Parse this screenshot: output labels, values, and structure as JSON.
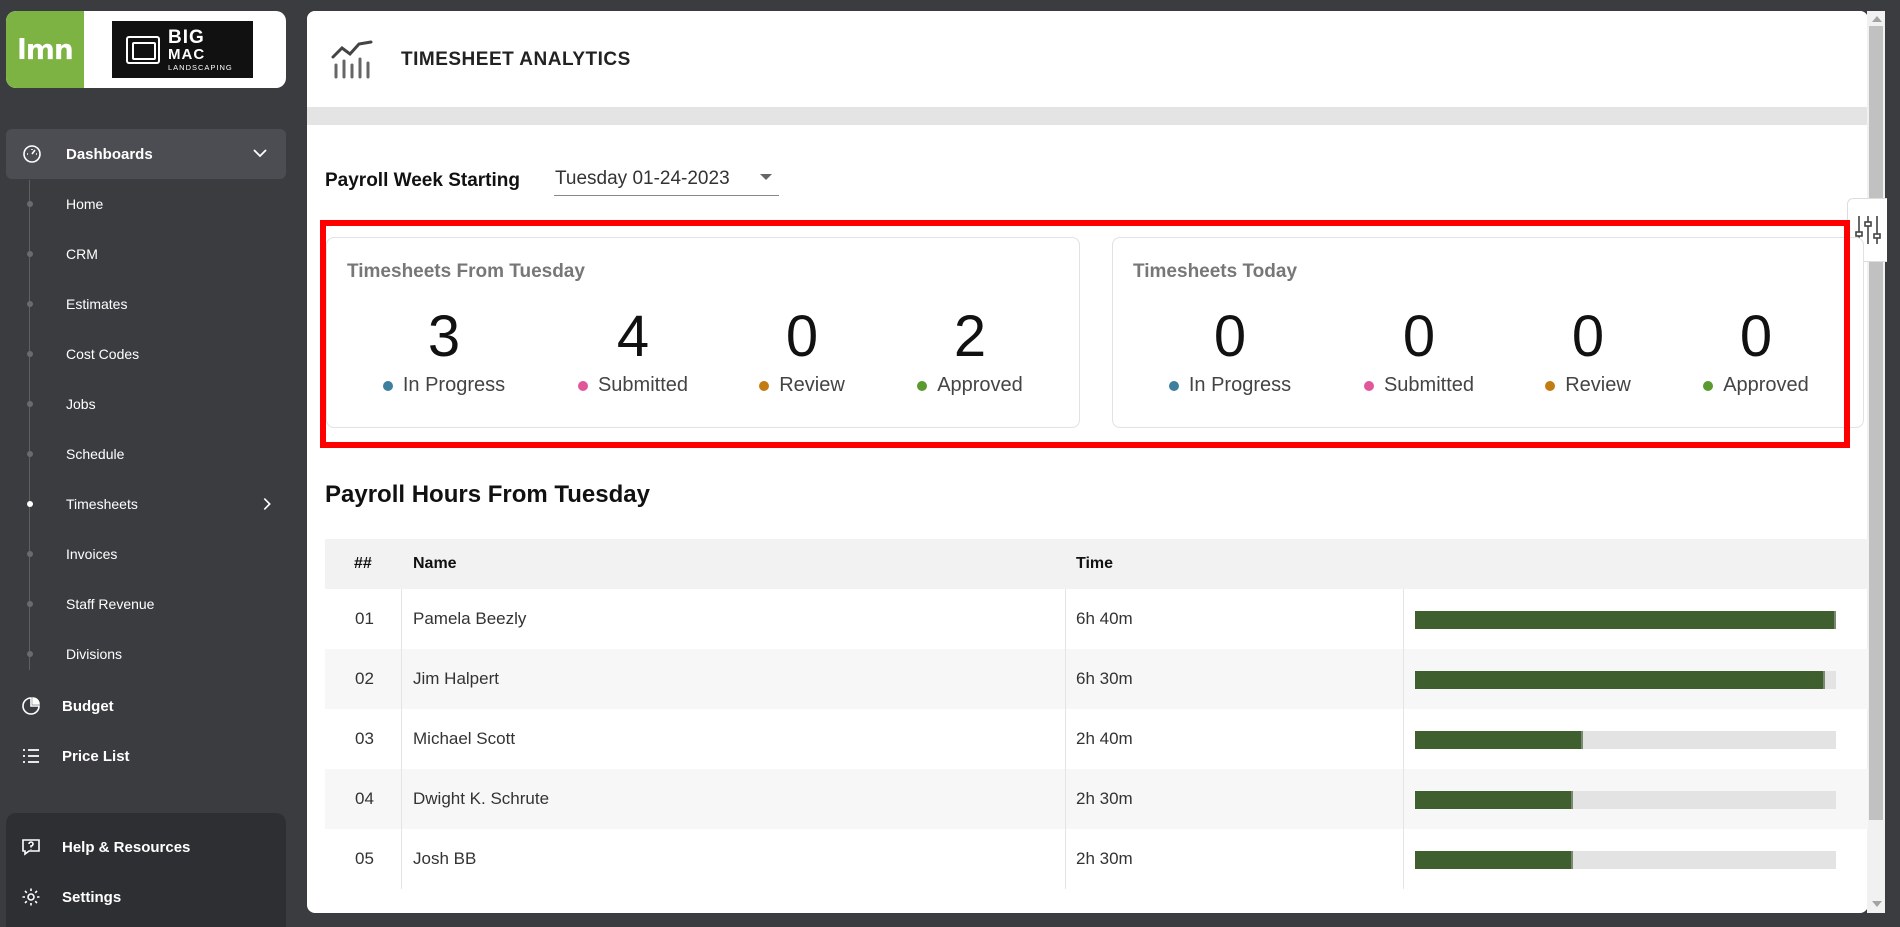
{
  "brand": {
    "lmn_logo": "lmn",
    "company_logo_line1": "BIG",
    "company_logo_line2": "MAC",
    "company_logo_line3": "LANDSCAPING"
  },
  "sidebar": {
    "section": {
      "label": "Dashboards",
      "icon": "gauge-icon"
    },
    "sub_items": [
      {
        "label": "Home"
      },
      {
        "label": "CRM"
      },
      {
        "label": "Estimates"
      },
      {
        "label": "Cost Codes"
      },
      {
        "label": "Jobs"
      },
      {
        "label": "Schedule"
      },
      {
        "label": "Timesheets",
        "active": true
      },
      {
        "label": "Invoices"
      },
      {
        "label": "Staff Revenue"
      },
      {
        "label": "Divisions"
      }
    ],
    "items": [
      {
        "label": "Budget",
        "icon": "pie-chart-icon"
      },
      {
        "label": "Price List",
        "icon": "list-icon"
      }
    ],
    "bottom_items": [
      {
        "label": "Help & Resources",
        "icon": "help-icon"
      },
      {
        "label": "Settings",
        "icon": "gear-icon"
      }
    ]
  },
  "header": {
    "title": "TIMESHEET ANALYTICS",
    "icon": "analytics-chart-icon"
  },
  "payroll_week": {
    "label": "Payroll Week Starting",
    "selected": "Tuesday 01-24-2023"
  },
  "colors": {
    "in_progress": "#3f7f9e",
    "submitted": "#e0579b",
    "review": "#c27c12",
    "approved": "#5a9a2e",
    "bar": "#3f5f2e",
    "highlight": "#ff0000"
  },
  "cards": [
    {
      "title": "Timesheets From Tuesday",
      "stats": [
        {
          "value": "3",
          "label": "In Progress"
        },
        {
          "value": "4",
          "label": "Submitted"
        },
        {
          "value": "0",
          "label": "Review"
        },
        {
          "value": "2",
          "label": "Approved"
        }
      ]
    },
    {
      "title": "Timesheets Today",
      "stats": [
        {
          "value": "0",
          "label": "In Progress"
        },
        {
          "value": "0",
          "label": "Submitted"
        },
        {
          "value": "0",
          "label": "Review"
        },
        {
          "value": "0",
          "label": "Approved"
        }
      ]
    }
  ],
  "payroll_hours": {
    "title": "Payroll Hours From Tuesday",
    "columns": [
      "##",
      "Name",
      "Time"
    ],
    "rows": [
      {
        "num": "01",
        "name": "Pamela Beezly",
        "time": "6h 40m",
        "fraction": 1.0
      },
      {
        "num": "02",
        "name": "Jim Halpert",
        "time": "6h 30m",
        "fraction": 0.975
      },
      {
        "num": "03",
        "name": "Michael Scott",
        "time": "2h 40m",
        "fraction": 0.4
      },
      {
        "num": "04",
        "name": "Dwight K. Schrute",
        "time": "2h 30m",
        "fraction": 0.375
      },
      {
        "num": "05",
        "name": "Josh BB",
        "time": "2h 30m",
        "fraction": 0.375
      }
    ]
  }
}
